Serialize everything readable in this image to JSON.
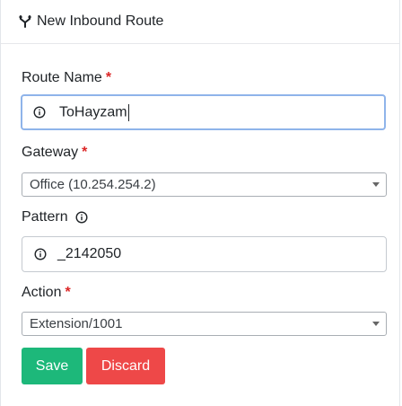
{
  "header": {
    "icon": "route-icon",
    "title": "New Inbound Route"
  },
  "form": {
    "route_name": {
      "label": "Route Name",
      "required_mark": "*",
      "value": "ToHayzam",
      "icon": "info-icon"
    },
    "gateway": {
      "label": "Gateway",
      "required_mark": "*",
      "selected": "Office (10.254.254.2)"
    },
    "pattern": {
      "label": "Pattern",
      "label_icon": "info-icon",
      "value": "_2142050",
      "icon": "info-icon"
    },
    "action": {
      "label": "Action",
      "required_mark": "*",
      "selected": "Extension/1001"
    }
  },
  "buttons": {
    "save_label": "Save",
    "discard_label": "Discard"
  },
  "colors": {
    "save": "#1db87a",
    "discard": "#ee4848",
    "required": "#dc2626",
    "focus_border": "#8fb4ea"
  }
}
